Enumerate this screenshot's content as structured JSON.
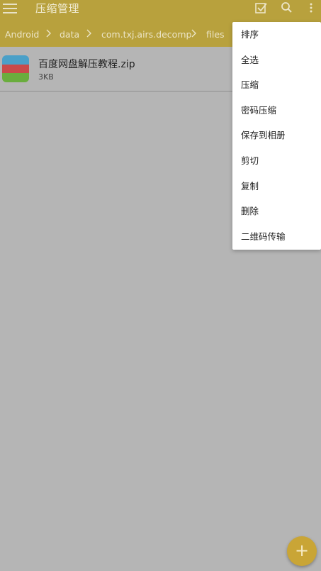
{
  "header": {
    "title": "压缩管理",
    "colors": {
      "bar": "#b8a13d"
    }
  },
  "breadcrumbs": [
    "Android",
    "data",
    "com.txj.airs.decomp",
    "files"
  ],
  "files": [
    {
      "name": "百度网盘解压教程.zip",
      "size": "3KB",
      "icon": "zip-archive-icon"
    }
  ],
  "popup_menu": {
    "items": [
      "排序",
      "全选",
      "压缩",
      "密码压缩",
      "保存到相册",
      "剪切",
      "复制",
      "删除",
      "二维码传输"
    ]
  },
  "fab": {
    "label": "+",
    "icon": "add-icon",
    "color": "#c9a536"
  }
}
